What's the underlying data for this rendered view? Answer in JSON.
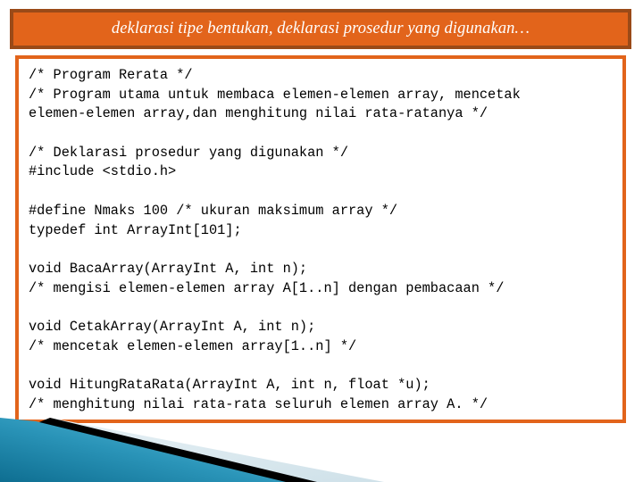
{
  "slide": {
    "title": "deklarasi tipe bentukan, deklarasi prosedur yang digunakan…",
    "colors": {
      "title_fill": "#E2641B",
      "title_border": "#9A4A18",
      "title_text": "#FFFFFF",
      "code_border": "#E2641B",
      "code_background": "#FFFFFF",
      "code_text": "#000000",
      "deco_teal_dark": "#127B9E",
      "deco_teal_light": "#5FC0DE",
      "deco_black": "#000000",
      "deco_pale_blue": "#D8E6EC"
    }
  },
  "code": {
    "lines": [
      "/* Program Rerata */",
      "/* Program utama untuk membaca elemen-elemen array, mencetak",
      "elemen-elemen array,dan menghitung nilai rata-ratanya */",
      "",
      "/* Deklarasi prosedur yang digunakan */",
      "#include <stdio.h>",
      "",
      "#define Nmaks 100 /* ukuran maksimum array */",
      "typedef int ArrayInt[101];",
      "",
      "void BacaArray(ArrayInt A, int n);",
      "/* mengisi elemen-elemen array A[1..n] dengan pembacaan */",
      "",
      "void CetakArray(ArrayInt A, int n);",
      "/* mencetak elemen-elemen array[1..n] */",
      "",
      "void HitungRataRata(ArrayInt A, int n, float *u);",
      "/* menghitung nilai rata-rata seluruh elemen array A. */"
    ]
  }
}
